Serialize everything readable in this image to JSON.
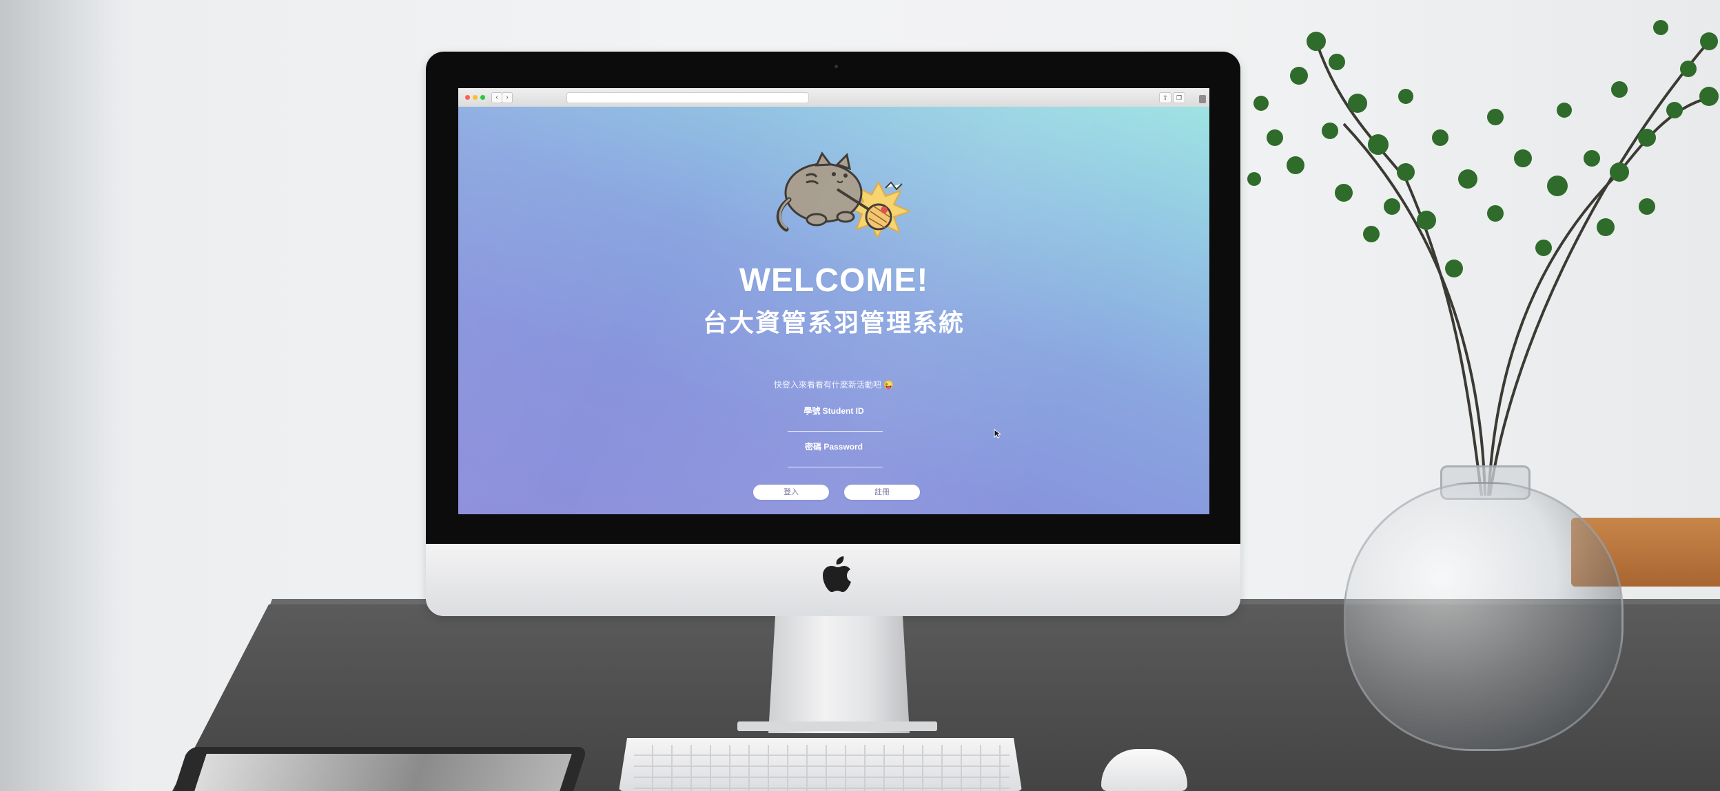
{
  "browser": {
    "address_text": "",
    "controls": {
      "back": "‹",
      "forward": "›",
      "share": "⇪",
      "tabs": "❐"
    }
  },
  "page": {
    "welcome": "WELCOME!",
    "system_title": "台大資管系羽管理系統",
    "tagline": "快登入來看看有什麼新活動吧 😜",
    "student_id_label": "學號 Student ID",
    "password_label": "密碼 Password",
    "student_id_value": "",
    "password_value": "",
    "login_button": "登入",
    "register_button": "註冊"
  },
  "colors": {
    "gradient_top_right": "#9ee3e3",
    "gradient_bottom_left": "#8e8fdb",
    "button_text": "#6d6f9c"
  },
  "icons": {
    "mascot": "cat-badminton-mascot",
    "device_logo": "apple-icon",
    "cursor": "mouse-pointer-icon"
  }
}
